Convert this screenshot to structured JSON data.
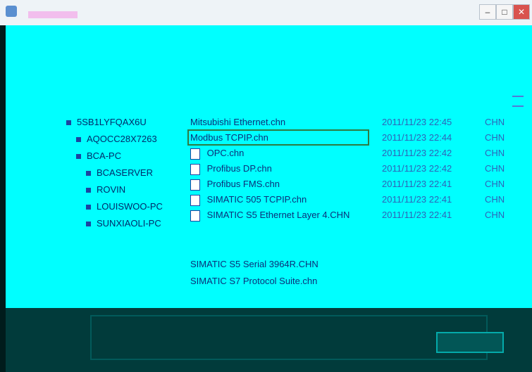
{
  "window": {
    "title": "",
    "buttons": {
      "minimize": "–",
      "maximize": "□",
      "close": "✕"
    }
  },
  "toolbar": {
    "label": ""
  },
  "tree": {
    "items": [
      {
        "label": "5SB1LYFQAX6U"
      },
      {
        "label": "AQOCC28X7263"
      },
      {
        "label": "BCA-PC"
      },
      {
        "label": "BCASERVER"
      },
      {
        "label": "ROVIN"
      },
      {
        "label": "LOUISWOO-PC"
      },
      {
        "label": "SUNXIAOLI-PC"
      }
    ]
  },
  "files": {
    "rows": [
      {
        "name": "Mitsubishi Ethernet.chn",
        "date": "2011/11/23 22:45",
        "type": "CHN"
      },
      {
        "name": "Modbus TCPIP.chn",
        "date": "2011/11/23 22:44",
        "type": "CHN"
      },
      {
        "name": "OPC.chn",
        "date": "2011/11/23 22:42",
        "type": "CHN"
      },
      {
        "name": "Profibus DP.chn",
        "date": "2011/11/23 22:42",
        "type": "CHN"
      },
      {
        "name": "Profibus FMS.chn",
        "date": "2011/11/23 22:41",
        "type": "CHN"
      },
      {
        "name": "SIMATIC 505 TCPIP.chn",
        "date": "2011/11/23 22:41",
        "type": "CHN"
      },
      {
        "name": "SIMATIC S5 Ethernet Layer 4.CHN",
        "date": "2011/11/23 22:41",
        "type": "CHN"
      },
      {
        "name": "SIMATIC S5 Serial 3964R.CHN",
        "date": "",
        "type": ""
      },
      {
        "name": "SIMATIC S7 Protocol Suite.chn",
        "date": "",
        "type": ""
      }
    ],
    "selected_index": 1
  },
  "bottom": {
    "button_label": ""
  }
}
